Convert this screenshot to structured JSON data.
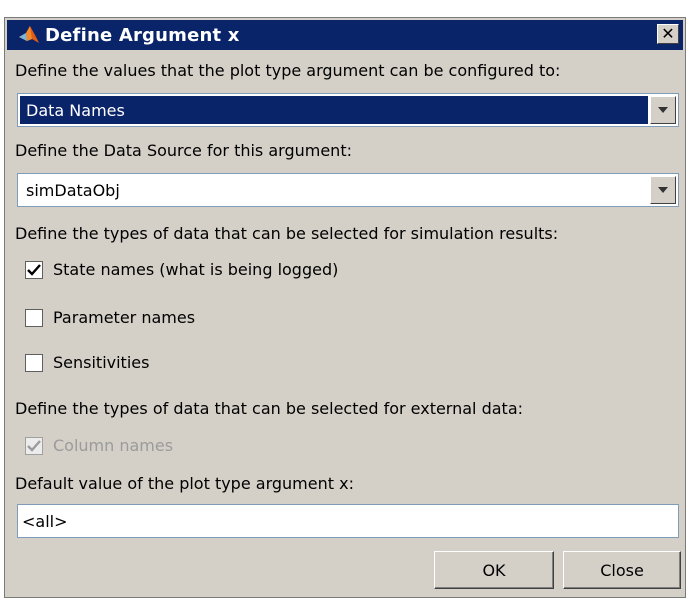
{
  "window": {
    "title": "Define Argument x",
    "close_label": "✕"
  },
  "labels": {
    "values_prompt": "Define the values that the plot type argument can be configured to:",
    "source_prompt": "Define the Data Source for this argument:",
    "sim_types_prompt": "Define the types of data that can be selected for simulation results:",
    "ext_types_prompt": "Define the types of data that can be selected for external data:",
    "default_prompt": "Default value of the plot type argument x:"
  },
  "values_select": {
    "value": "Data Names"
  },
  "source_select": {
    "value": "simDataObj"
  },
  "sim_options": [
    {
      "label": "State names (what is being logged)",
      "checked": true
    },
    {
      "label": "Parameter names",
      "checked": false
    },
    {
      "label": "Sensitivities",
      "checked": false
    }
  ],
  "ext_options": [
    {
      "label": "Column names",
      "checked": true,
      "disabled": true
    }
  ],
  "default_value": "<all>",
  "buttons": {
    "ok": "OK",
    "close": "Close"
  }
}
